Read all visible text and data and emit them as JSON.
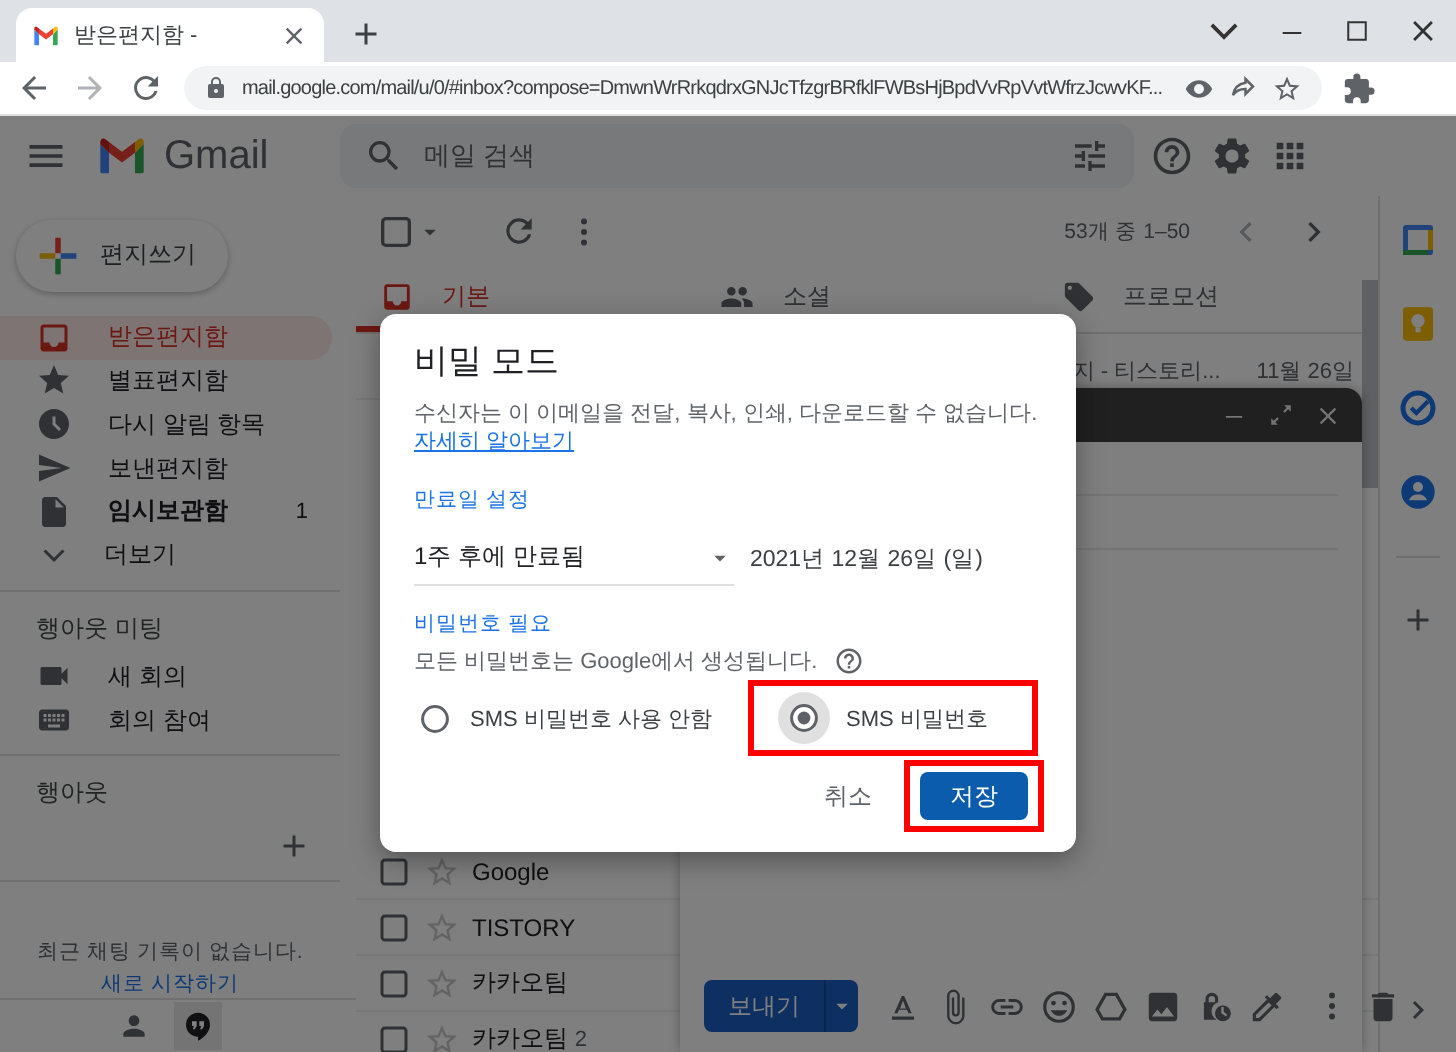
{
  "browser": {
    "tab_title": "받은편지함 -",
    "url": "mail.google.com/mail/u/0/#inbox?compose=DmwnWrRrkqdrxGNJcTfzgrBRfklFWBsHjBpdVvRpVvtWfrzJcwvKF..."
  },
  "header": {
    "logo_text": "Gmail",
    "search_placeholder": "메일 검색"
  },
  "sidebar": {
    "compose_label": "편지쓰기",
    "items": [
      {
        "kind": "inbox",
        "label": "받은편지함",
        "selected": true,
        "bold": false
      },
      {
        "kind": "star",
        "label": "별표편지함",
        "selected": false,
        "bold": false
      },
      {
        "kind": "clock",
        "label": "다시 알림 항목",
        "selected": false,
        "bold": false
      },
      {
        "kind": "send",
        "label": "보낸편지함",
        "selected": false,
        "bold": false
      },
      {
        "kind": "draft",
        "label": "임시보관함",
        "selected": false,
        "bold": true,
        "count": "1"
      },
      {
        "kind": "more",
        "label": "더보기",
        "selected": false,
        "bold": false
      }
    ],
    "meet": {
      "heading": "행아웃 미팅",
      "items": [
        {
          "kind": "video",
          "label": "새 회의"
        },
        {
          "kind": "keyboard",
          "label": "회의 참여"
        }
      ]
    },
    "hangouts": {
      "heading": "행아웃",
      "empty_text": "최근 채팅 기록이 없습니다.",
      "start_link": "새로 시작하기"
    }
  },
  "toolbar": {
    "range": "53개 중 1–50"
  },
  "tabs": [
    {
      "kind": "inbox",
      "label": "기본",
      "selected": true
    },
    {
      "kind": "people",
      "label": "소셜",
      "selected": false
    },
    {
      "kind": "tag",
      "label": "프로모션",
      "selected": false
    }
  ],
  "emails_top": [
    {
      "snippet": "지 - 티스토리...",
      "date": "11월 26일"
    }
  ],
  "emails_bottom": [
    {
      "sender": "Google"
    },
    {
      "sender": "TISTORY"
    },
    {
      "sender": "카카오팀"
    },
    {
      "sender": "카카오팀",
      "count": "2"
    }
  ],
  "compose": {
    "send_label": "보내기"
  },
  "dialog": {
    "title": "비밀 모드",
    "description": "수신자는 이 이메일을 전달, 복사, 인쇄, 다운로드할 수 없습니다.",
    "learn_more": "자세히 알아보기",
    "expiry_heading": "만료일 설정",
    "expiry_value": "1주 후에 만료됨",
    "expiry_date": "2021년 12월 26일 (일)",
    "password_heading": "비밀번호 필요",
    "password_note": "모든 비밀번호는 Google에서 생성됩니다.",
    "options": [
      {
        "label": "SMS 비밀번호 사용 안함",
        "selected": false,
        "highlighted": false
      },
      {
        "label": "SMS 비밀번호",
        "selected": true,
        "highlighted": true
      }
    ],
    "buttons": [
      {
        "kind": "text",
        "label": "취소",
        "highlighted": false
      },
      {
        "kind": "primary",
        "label": "저장",
        "highlighted": true
      }
    ]
  }
}
